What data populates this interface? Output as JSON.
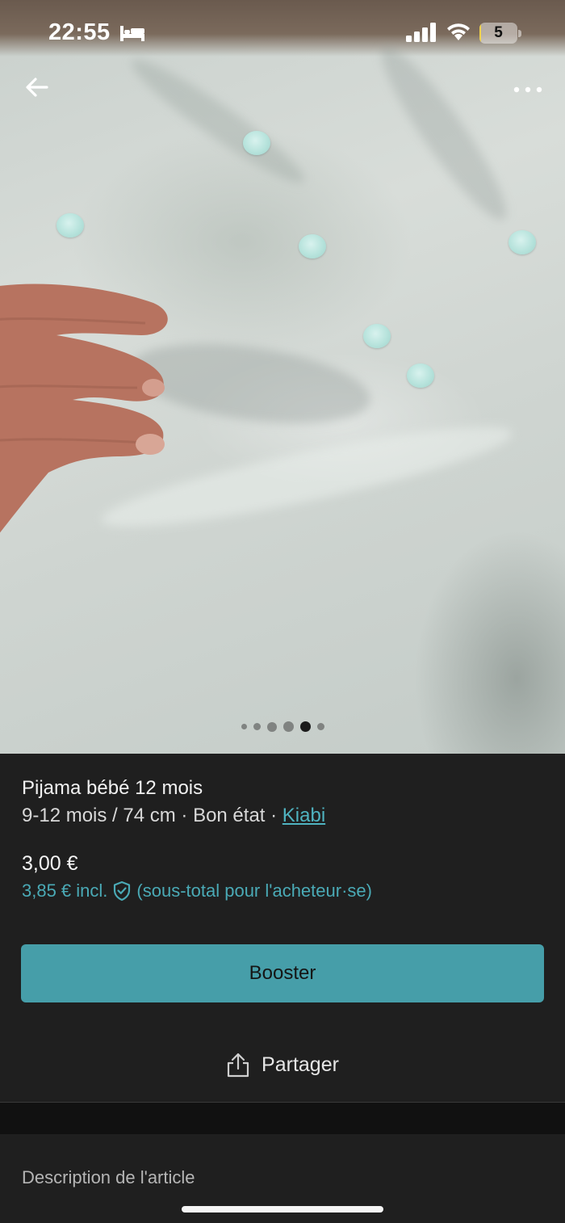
{
  "status_bar": {
    "time": "22:55",
    "battery_level": "5",
    "battery_fraction": 0.05
  },
  "photo": {
    "carousel_total": 6,
    "carousel_active_index": 4
  },
  "item": {
    "title": "Pijama bébé 12 mois",
    "size": "9-12 mois / 74 cm",
    "separator": " · ",
    "condition": "Bon état",
    "brand": "Kiabi",
    "price": "3,00 €",
    "buyer_price": "3,85 € incl.",
    "buyer_price_note": "(sous-total pour l'acheteur·se)"
  },
  "actions": {
    "boost_label": "Booster",
    "share_label": "Partager"
  },
  "description": {
    "title": "Description de l'article"
  },
  "colors": {
    "accent": "#469ea9",
    "link": "#4fb3c0",
    "background": "#1f1f1f"
  },
  "icons": [
    "bed-icon",
    "signal-icon",
    "wifi-icon",
    "battery-icon",
    "back-arrow-icon",
    "more-icon",
    "shield-check-icon",
    "share-icon"
  ]
}
